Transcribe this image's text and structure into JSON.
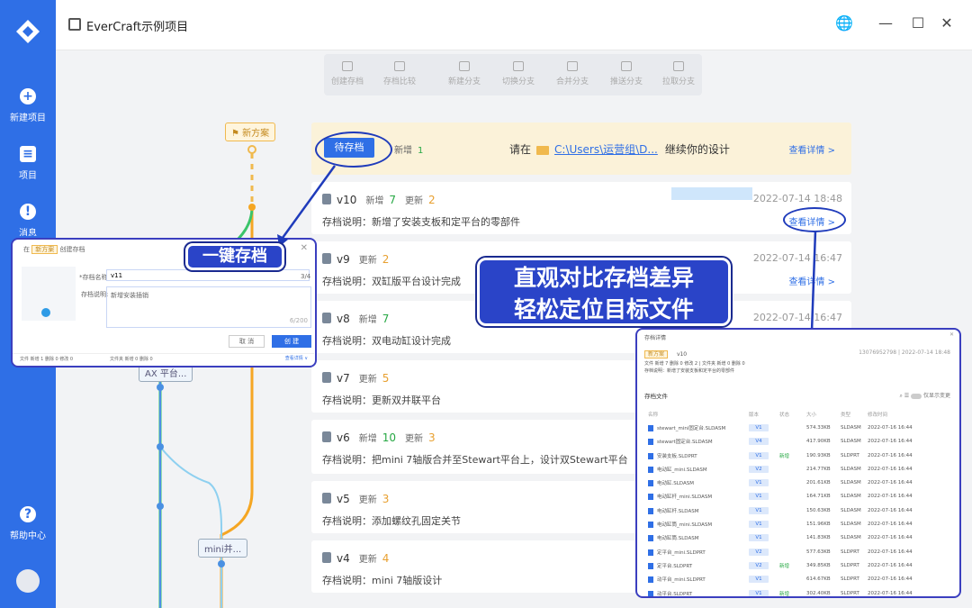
{
  "sidebar": {
    "items": [
      {
        "label": "新建项目"
      },
      {
        "label": "项目"
      },
      {
        "label": "消息"
      },
      {
        "label": "帮助中心"
      }
    ]
  },
  "titlebar": {
    "title": "EverCraft示例项目",
    "controls": [
      "🌐",
      "—",
      "☐",
      "✕"
    ]
  },
  "toolbar": {
    "tools": [
      "创建存档",
      "存档比较",
      "新建分支",
      "切换分支",
      "合并分支",
      "推送分支",
      "拉取分支"
    ]
  },
  "graph": {
    "new_plan_tag": "新方案",
    "branch_tag_ax": "AX 平台...",
    "branch_tag_mini": "mini并..."
  },
  "pending": {
    "button": "待存档",
    "added_label": "新增",
    "added": "1",
    "prompt_prefix": "请在",
    "path": "C:\\Users\\运营组\\D...",
    "prompt_suffix": "继续你的设计",
    "detail": "查看详情 >"
  },
  "cards": [
    {
      "ver": "v10",
      "added": "7",
      "updated": "2",
      "desc": "存档说明：新增了安装支板和定平台的零部件",
      "date": "2022-07-14 18:48",
      "detail": "查看详情 >"
    },
    {
      "ver": "v9",
      "updated": "2",
      "desc": "存档说明：双缸版平台设计完成",
      "date": "2022-07-14 16:47",
      "detail": "查看详情 >"
    },
    {
      "ver": "v8",
      "added": "7",
      "desc": "存档说明：双电动缸设计完成",
      "date": "2022-07-14 16:47"
    },
    {
      "ver": "v7",
      "updated": "5",
      "desc": "存档说明：更新双并联平台"
    },
    {
      "ver": "v6",
      "added": "10",
      "updated": "3",
      "desc": "存档说明：把mini 7轴版合并至Stewart平台上，设计双Stewart平台"
    },
    {
      "ver": "v5",
      "updated": "3",
      "desc": "存档说明：添加螺纹孔固定关节"
    },
    {
      "ver": "v4",
      "updated": "4",
      "desc": "存档说明：mini 7轴版设计"
    }
  ],
  "labels": {
    "added": "新增",
    "updated": "更新"
  },
  "dialog": {
    "title_prefix": "在",
    "tag": "新方案",
    "title_suffix": "创建存档",
    "name_label": "*存档名称:",
    "name_value": "v11",
    "name_count": "3/4",
    "desc_label": "存档说明:",
    "desc_placeholder": "新增安装插销",
    "desc_count": "6/200",
    "cancel": "取 消",
    "create": "创 建",
    "footer_files": "文件  新增 1   删除 0   修改 0",
    "footer_folders": "文件夹  新增 0   删除 0",
    "footer_detail": "查看详情 ∨"
  },
  "callouts": {
    "save": "一键存档",
    "compare_line1": "直观对比存档差异",
    "compare_line2": "轻松定位目标文件"
  },
  "compare": {
    "title": "存档详情",
    "tag": "新方案",
    "ver": "v10",
    "user": "13076952798",
    "date": "2022-07-14 18:48",
    "stats": "文件  新增 7   删除 0   修改 2  |  文件夹  新增 0   删除 0",
    "desc": "存档说明：新增了安装支板和定平台的零部件",
    "section": "存档文件",
    "toggle": "仅显示变更",
    "columns": [
      "名称",
      "版本",
      "状态",
      "大小",
      "类型",
      "修改时间"
    ],
    "rows": [
      [
        "stewart_mini固定台.SLDASM",
        "V1",
        "",
        "574.33KB",
        "SLDASM",
        "2022-07-16 16:44"
      ],
      [
        "stewart固定台.SLDASM",
        "V4",
        "",
        "417.90KB",
        "SLDASM",
        "2022-07-16 16:44"
      ],
      [
        "安装支板.SLDPRT",
        "V1",
        "新增",
        "190.93KB",
        "SLDPRT",
        "2022-07-16 16:44"
      ],
      [
        "电动缸_mini.SLDASM",
        "V2",
        "",
        "214.77KB",
        "SLDASM",
        "2022-07-16 16:44"
      ],
      [
        "电动缸.SLDASM",
        "V1",
        "",
        "201.61KB",
        "SLDASM",
        "2022-07-16 16:44"
      ],
      [
        "电动缸杆_mini.SLDASM",
        "V1",
        "",
        "164.71KB",
        "SLDASM",
        "2022-07-16 16:44"
      ],
      [
        "电动缸杆.SLDASM",
        "V1",
        "",
        "150.63KB",
        "SLDASM",
        "2022-07-16 16:44"
      ],
      [
        "电动缸筒_mini.SLDASM",
        "V1",
        "",
        "151.96KB",
        "SLDASM",
        "2022-07-16 16:44"
      ],
      [
        "电动缸筒.SLDASM",
        "V1",
        "",
        "141.83KB",
        "SLDASM",
        "2022-07-16 16:44"
      ],
      [
        "定平台_mini.SLDPRT",
        "V2",
        "",
        "577.63KB",
        "SLDPRT",
        "2022-07-16 16:44"
      ],
      [
        "定平台.SLDPRT",
        "V2",
        "新增",
        "349.85KB",
        "SLDPRT",
        "2022-07-16 16:44"
      ],
      [
        "动平台_mini.SLDPRT",
        "V1",
        "",
        "614.67KB",
        "SLDPRT",
        "2022-07-16 16:44"
      ],
      [
        "动平台.SLDPRT",
        "V1",
        "新增",
        "302.40KB",
        "SLDPRT",
        "2022-07-16 16:44"
      ]
    ]
  }
}
